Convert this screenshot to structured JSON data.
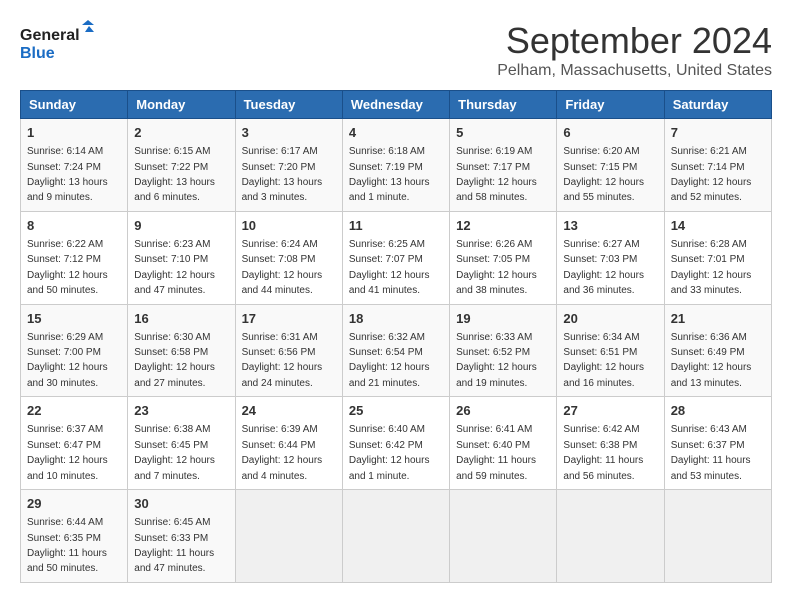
{
  "logo": {
    "line1": "General",
    "line2": "Blue"
  },
  "title": "September 2024",
  "subtitle": "Pelham, Massachusetts, United States",
  "days_of_week": [
    "Sunday",
    "Monday",
    "Tuesday",
    "Wednesday",
    "Thursday",
    "Friday",
    "Saturday"
  ],
  "weeks": [
    [
      {
        "day": "1",
        "sunrise": "6:14 AM",
        "sunset": "7:24 PM",
        "daylight": "13 hours and 9 minutes."
      },
      {
        "day": "2",
        "sunrise": "6:15 AM",
        "sunset": "7:22 PM",
        "daylight": "13 hours and 6 minutes."
      },
      {
        "day": "3",
        "sunrise": "6:17 AM",
        "sunset": "7:20 PM",
        "daylight": "13 hours and 3 minutes."
      },
      {
        "day": "4",
        "sunrise": "6:18 AM",
        "sunset": "7:19 PM",
        "daylight": "13 hours and 1 minute."
      },
      {
        "day": "5",
        "sunrise": "6:19 AM",
        "sunset": "7:17 PM",
        "daylight": "12 hours and 58 minutes."
      },
      {
        "day": "6",
        "sunrise": "6:20 AM",
        "sunset": "7:15 PM",
        "daylight": "12 hours and 55 minutes."
      },
      {
        "day": "7",
        "sunrise": "6:21 AM",
        "sunset": "7:14 PM",
        "daylight": "12 hours and 52 minutes."
      }
    ],
    [
      {
        "day": "8",
        "sunrise": "6:22 AM",
        "sunset": "7:12 PM",
        "daylight": "12 hours and 50 minutes."
      },
      {
        "day": "9",
        "sunrise": "6:23 AM",
        "sunset": "7:10 PM",
        "daylight": "12 hours and 47 minutes."
      },
      {
        "day": "10",
        "sunrise": "6:24 AM",
        "sunset": "7:08 PM",
        "daylight": "12 hours and 44 minutes."
      },
      {
        "day": "11",
        "sunrise": "6:25 AM",
        "sunset": "7:07 PM",
        "daylight": "12 hours and 41 minutes."
      },
      {
        "day": "12",
        "sunrise": "6:26 AM",
        "sunset": "7:05 PM",
        "daylight": "12 hours and 38 minutes."
      },
      {
        "day": "13",
        "sunrise": "6:27 AM",
        "sunset": "7:03 PM",
        "daylight": "12 hours and 36 minutes."
      },
      {
        "day": "14",
        "sunrise": "6:28 AM",
        "sunset": "7:01 PM",
        "daylight": "12 hours and 33 minutes."
      }
    ],
    [
      {
        "day": "15",
        "sunrise": "6:29 AM",
        "sunset": "7:00 PM",
        "daylight": "12 hours and 30 minutes."
      },
      {
        "day": "16",
        "sunrise": "6:30 AM",
        "sunset": "6:58 PM",
        "daylight": "12 hours and 27 minutes."
      },
      {
        "day": "17",
        "sunrise": "6:31 AM",
        "sunset": "6:56 PM",
        "daylight": "12 hours and 24 minutes."
      },
      {
        "day": "18",
        "sunrise": "6:32 AM",
        "sunset": "6:54 PM",
        "daylight": "12 hours and 21 minutes."
      },
      {
        "day": "19",
        "sunrise": "6:33 AM",
        "sunset": "6:52 PM",
        "daylight": "12 hours and 19 minutes."
      },
      {
        "day": "20",
        "sunrise": "6:34 AM",
        "sunset": "6:51 PM",
        "daylight": "12 hours and 16 minutes."
      },
      {
        "day": "21",
        "sunrise": "6:36 AM",
        "sunset": "6:49 PM",
        "daylight": "12 hours and 13 minutes."
      }
    ],
    [
      {
        "day": "22",
        "sunrise": "6:37 AM",
        "sunset": "6:47 PM",
        "daylight": "12 hours and 10 minutes."
      },
      {
        "day": "23",
        "sunrise": "6:38 AM",
        "sunset": "6:45 PM",
        "daylight": "12 hours and 7 minutes."
      },
      {
        "day": "24",
        "sunrise": "6:39 AM",
        "sunset": "6:44 PM",
        "daylight": "12 hours and 4 minutes."
      },
      {
        "day": "25",
        "sunrise": "6:40 AM",
        "sunset": "6:42 PM",
        "daylight": "12 hours and 1 minute."
      },
      {
        "day": "26",
        "sunrise": "6:41 AM",
        "sunset": "6:40 PM",
        "daylight": "11 hours and 59 minutes."
      },
      {
        "day": "27",
        "sunrise": "6:42 AM",
        "sunset": "6:38 PM",
        "daylight": "11 hours and 56 minutes."
      },
      {
        "day": "28",
        "sunrise": "6:43 AM",
        "sunset": "6:37 PM",
        "daylight": "11 hours and 53 minutes."
      }
    ],
    [
      {
        "day": "29",
        "sunrise": "6:44 AM",
        "sunset": "6:35 PM",
        "daylight": "11 hours and 50 minutes."
      },
      {
        "day": "30",
        "sunrise": "6:45 AM",
        "sunset": "6:33 PM",
        "daylight": "11 hours and 47 minutes."
      },
      null,
      null,
      null,
      null,
      null
    ]
  ]
}
